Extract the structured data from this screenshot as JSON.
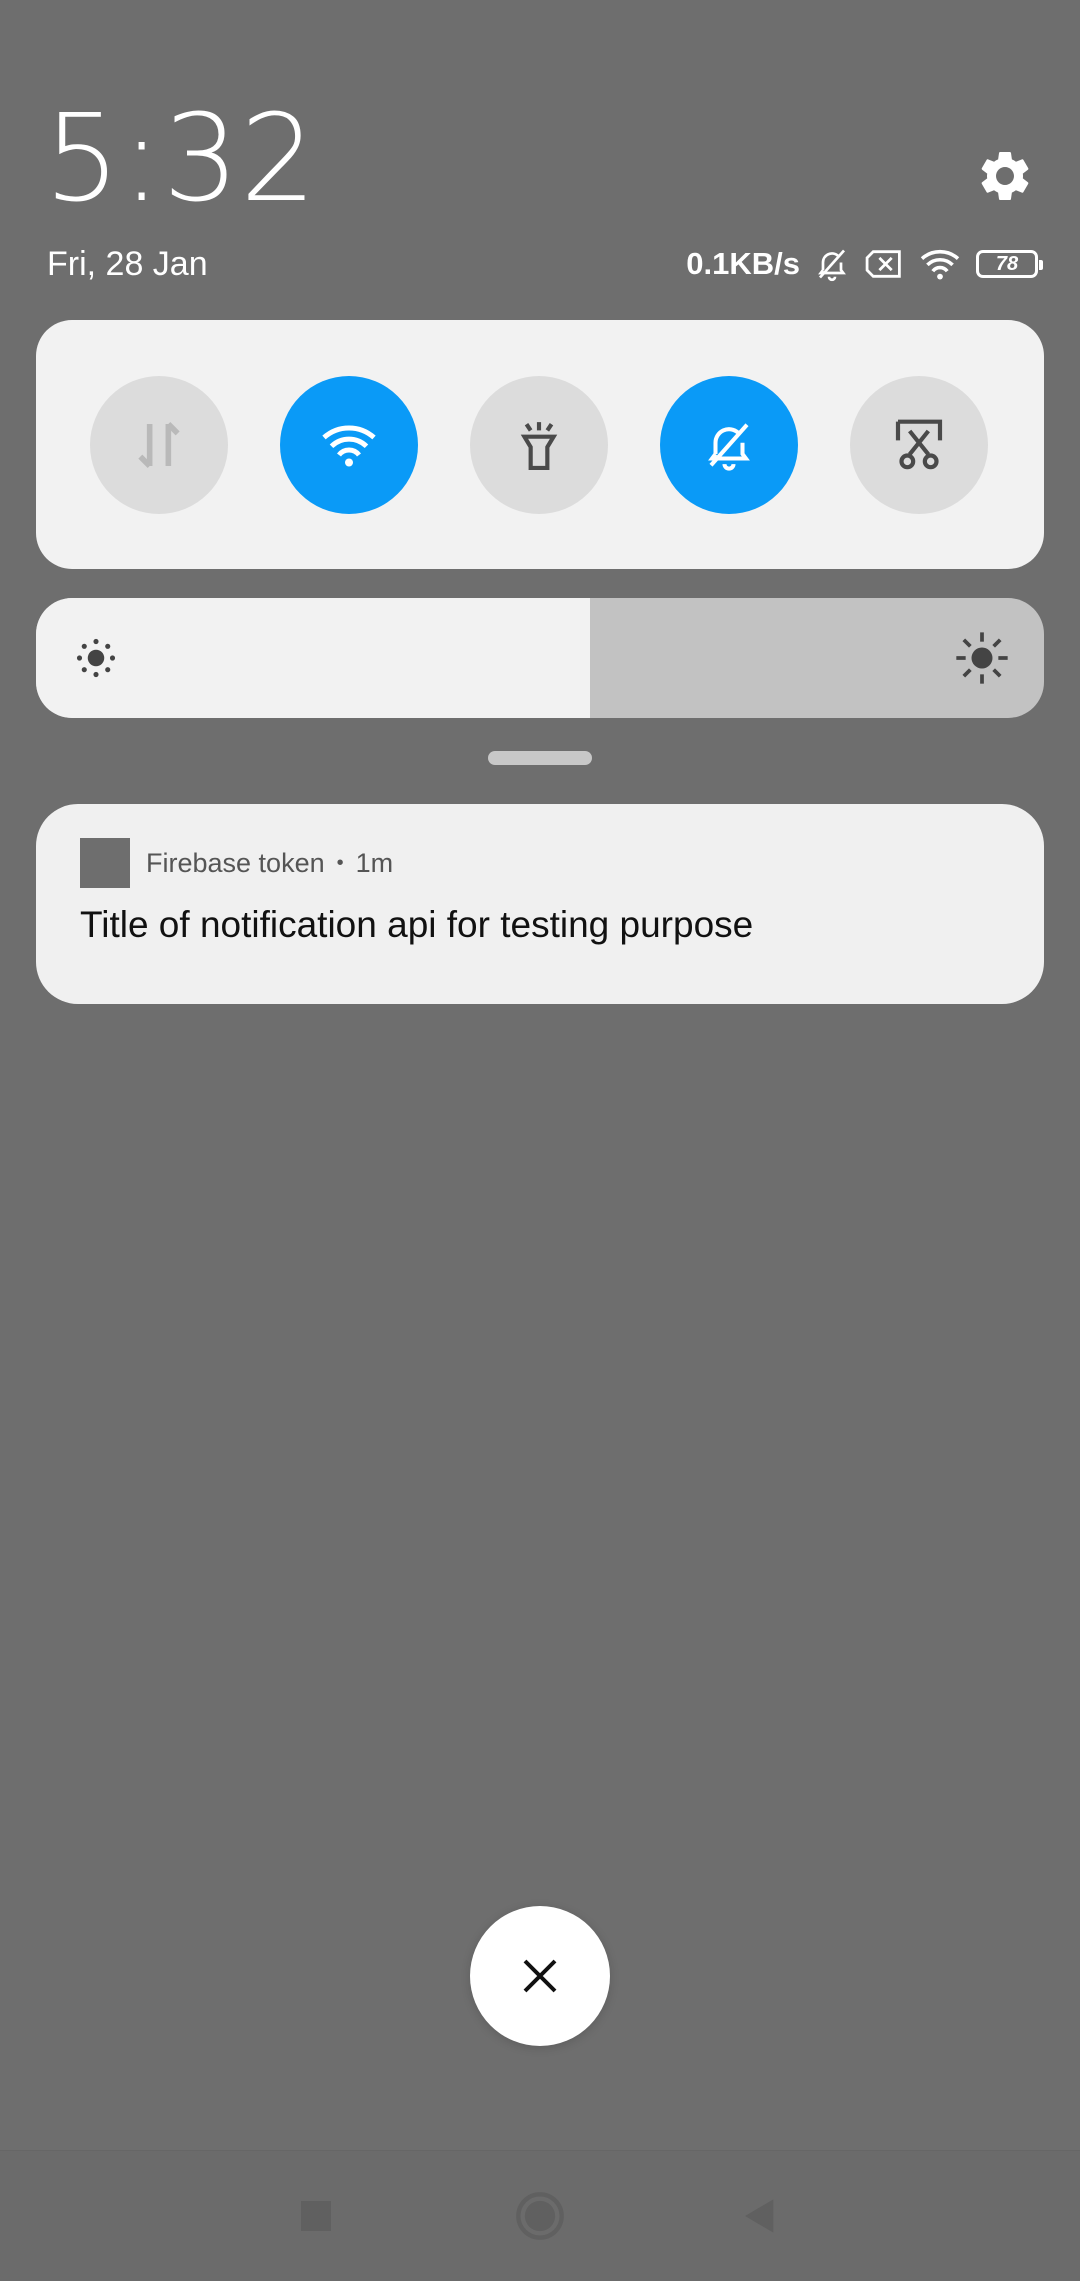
{
  "header": {
    "time": "5:32",
    "date": "Fri, 28 Jan",
    "settings_icon": "gear-icon"
  },
  "status_bar": {
    "network_speed": "0.1KB/s",
    "icons": [
      "bell-muted-icon",
      "no-sim-icon",
      "wifi-icon"
    ],
    "battery_level": "78"
  },
  "quick_settings": {
    "tiles": [
      {
        "icon": "mobile-data-icon",
        "state": "off"
      },
      {
        "icon": "wifi-icon",
        "state": "on"
      },
      {
        "icon": "flashlight-icon",
        "state": "off"
      },
      {
        "icon": "bell-muted-icon",
        "state": "on"
      },
      {
        "icon": "screenshot-scissors-icon",
        "state": "off"
      }
    ],
    "active_color": "#0a9af7",
    "inactive_color": "#dcdcdc"
  },
  "brightness": {
    "level": 0.55,
    "low_icon": "brightness-low-icon",
    "high_icon": "brightness-high-icon"
  },
  "notification": {
    "app_name": "Firebase token",
    "separator": "•",
    "time_ago": "1m",
    "title": "Title of notification api for testing purpose"
  },
  "dismiss_button": {
    "icon": "close-icon"
  },
  "navigation": {
    "icons": [
      "recents-square-icon",
      "home-circle-icon",
      "back-triangle-icon"
    ]
  }
}
